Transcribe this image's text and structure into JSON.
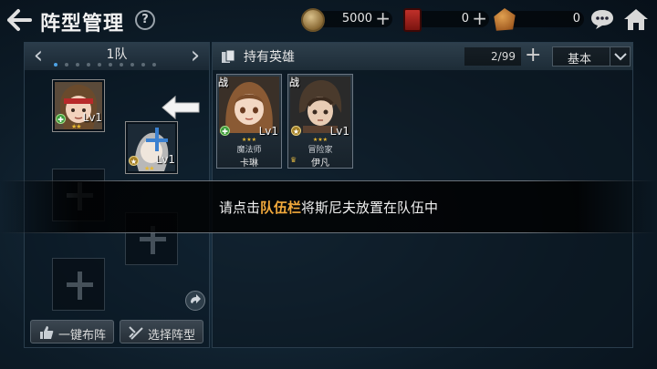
{
  "header": {
    "title": "阵型管理",
    "help_label": "?"
  },
  "resources": [
    {
      "icon": "coin-icon",
      "value": "5000",
      "plus": "+"
    },
    {
      "icon": "gem-icon",
      "value": "0",
      "plus": "+"
    },
    {
      "icon": "ore-icon",
      "value": "0"
    }
  ],
  "team": {
    "name": "1队",
    "dot_count": 10,
    "active_dot": 0,
    "slots": [
      {
        "filled": true,
        "level": "Lv1",
        "class_badge": "green",
        "stars": 2
      },
      {
        "filled": true,
        "level": "Lv1",
        "class_badge": "gold",
        "stars": 2
      },
      {
        "filled": false
      },
      {
        "filled": false
      },
      {
        "filled": false
      },
      {
        "filled": false
      }
    ],
    "auto_button": "一键布阵",
    "formation_button": "选择阵型"
  },
  "roster": {
    "title": "持有英雄",
    "count": "2/99",
    "plus": "+",
    "sort_label": "基本",
    "heroes": [
      {
        "tag": "战",
        "level": "Lv1",
        "job": "魔法师",
        "name": "卡琳",
        "class_badge": "green",
        "stars": 3
      },
      {
        "tag": "战",
        "level": "Lv1",
        "job": "冒险家",
        "name": "伊凡",
        "class_badge": "gold",
        "stars": 3
      }
    ]
  },
  "tutorial": {
    "text_before": "请点击",
    "highlight": "队伍栏",
    "text_after": "将斯尼夫放置在队伍中"
  },
  "colors": {
    "highlight": "#f2a93b",
    "active_dot": "#4ea3e6",
    "star": "#e8b830"
  }
}
